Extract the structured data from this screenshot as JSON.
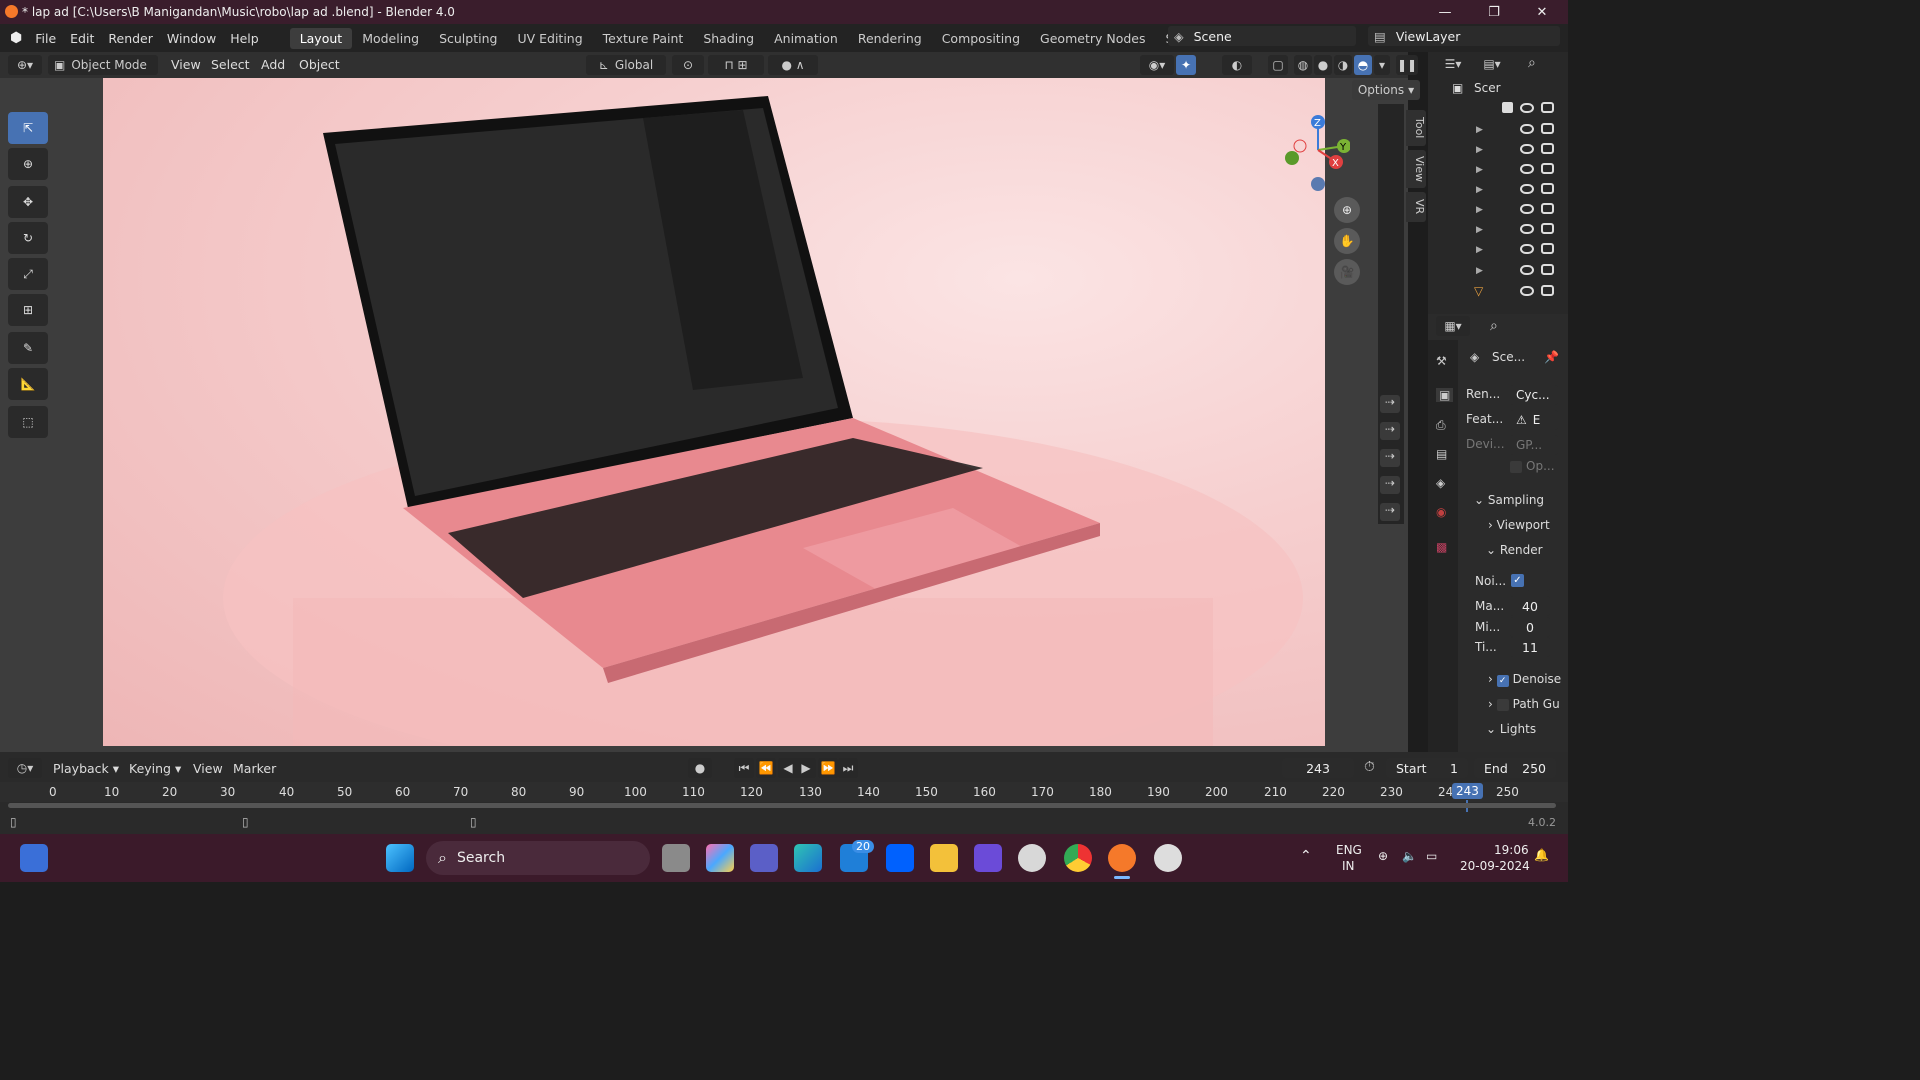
{
  "window": {
    "title": "* lap ad  [C:\\Users\\B Manigandan\\Music\\robo\\lap ad .blend] - Blender 4.0",
    "min": "—",
    "max": "❐",
    "close": "✕"
  },
  "menu": [
    "File",
    "Edit",
    "Render",
    "Window",
    "Help"
  ],
  "workspaces": [
    "Layout",
    "Modeling",
    "Sculpting",
    "UV Editing",
    "Texture Paint",
    "Shading",
    "Animation",
    "Rendering",
    "Compositing",
    "Geometry Nodes",
    "Scripting",
    "+"
  ],
  "scene": {
    "name": "Scene",
    "viewlayer": "ViewLayer"
  },
  "header3d": {
    "mode": "Object Mode",
    "menus": [
      "View",
      "Select",
      "Add",
      "Object"
    ],
    "orientation": "Global",
    "options": "Options"
  },
  "sidetabs": [
    "Tool",
    "View",
    "VR"
  ],
  "outliner": {
    "label": "Scer"
  },
  "props": {
    "scene_label": "Sce...",
    "render_label": "Ren...",
    "render_engine": "Cyc...",
    "feature_label": "Feat...",
    "feature_value": "E",
    "device_label": "Devi...",
    "device_value": "GP...",
    "open_label": "Op...",
    "sampling": "Sampling",
    "viewport": "Viewport",
    "render": "Render",
    "noise_label": "Noi...",
    "max_label": "Ma...",
    "max_value": "40",
    "min_label": "Mi...",
    "min_value": "0",
    "time_label": "Ti...",
    "time_value": "11",
    "denoise": "Denoise",
    "path_guiding": "Path Gu",
    "lights": "Lights"
  },
  "timeline": {
    "menus": [
      "Playback",
      "Keying",
      "View",
      "Marker"
    ],
    "current_frame": "243",
    "start_label": "Start",
    "start": "1",
    "end_label": "End",
    "end": "250",
    "ruler": [
      "0",
      "10",
      "20",
      "30",
      "40",
      "50",
      "60",
      "70",
      "80",
      "90",
      "100",
      "110",
      "120",
      "130",
      "140",
      "150",
      "160",
      "170",
      "180",
      "190",
      "200",
      "210",
      "220",
      "230",
      "24",
      "243",
      "250"
    ],
    "version": "4.0.2"
  },
  "taskbar": {
    "search": "Search",
    "lang": "ENG",
    "region": "IN",
    "time": "19:06",
    "date": "20-09-2024",
    "badge": "20"
  },
  "colors": {
    "accent": "#4772b3",
    "titlebar": "#3a1d2c",
    "taskbar": "#3b1a2a",
    "laptop": "#f2a0a8"
  }
}
